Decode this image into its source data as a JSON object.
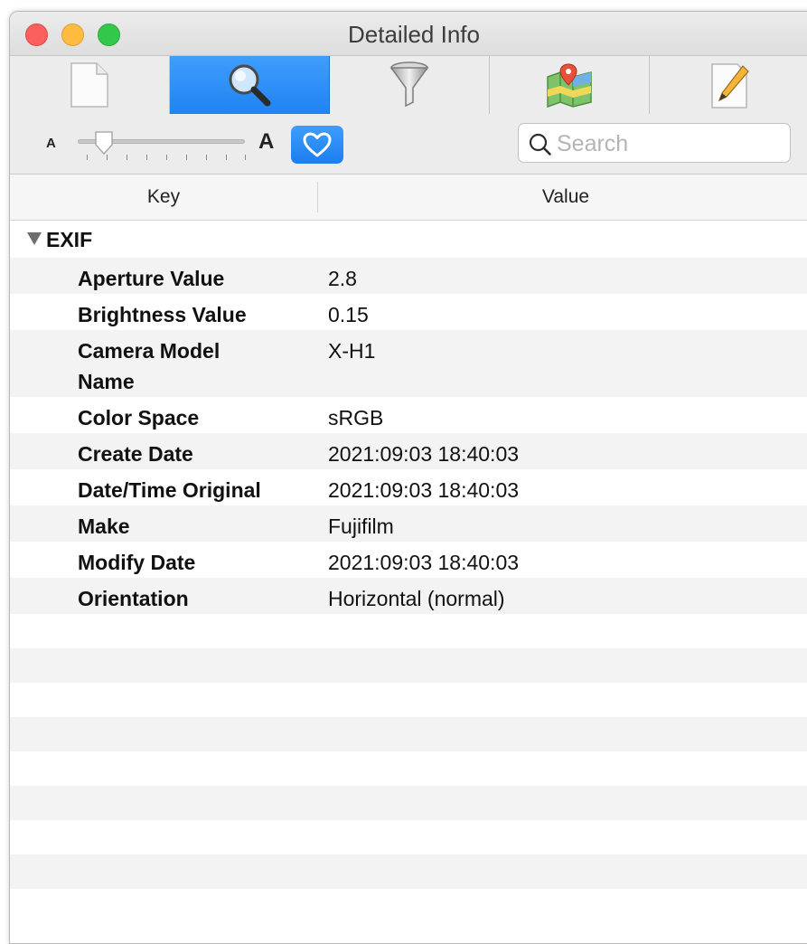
{
  "window": {
    "title": "Detailed Info"
  },
  "tabs": [
    {
      "icon": "document-icon"
    },
    {
      "icon": "magnifier-icon",
      "active": true
    },
    {
      "icon": "funnel-icon"
    },
    {
      "icon": "map-icon"
    },
    {
      "icon": "pencil-note-icon"
    }
  ],
  "toolbar": {
    "font_small_label": "A",
    "font_large_label": "A",
    "favorite_icon": "heart-icon",
    "search_placeholder": "Search",
    "search_value": ""
  },
  "table": {
    "headers": {
      "key": "Key",
      "value": "Value"
    },
    "group": {
      "label": "EXIF",
      "expanded": true
    },
    "rows": [
      {
        "key": "Aperture Value",
        "value": "2.8"
      },
      {
        "key": "Brightness Value",
        "value": "0.15"
      },
      {
        "key": "Camera Model Name",
        "value": "X-H1"
      },
      {
        "key": "Color Space",
        "value": "sRGB"
      },
      {
        "key": "Create Date",
        "value": "2021:09:03 18:40:03"
      },
      {
        "key": "Date/Time Original",
        "value": "2021:09:03 18:40:03"
      },
      {
        "key": "Make",
        "value": "Fujifilm"
      },
      {
        "key": "Modify Date",
        "value": "2021:09:03 18:40:03"
      },
      {
        "key": "Orientation",
        "value": "Horizontal (normal)"
      }
    ]
  },
  "colors": {
    "accent": "#1f84f2",
    "traffic_close": "#fc605c",
    "traffic_minimize": "#fdbc40",
    "traffic_maximize": "#34c84a"
  }
}
